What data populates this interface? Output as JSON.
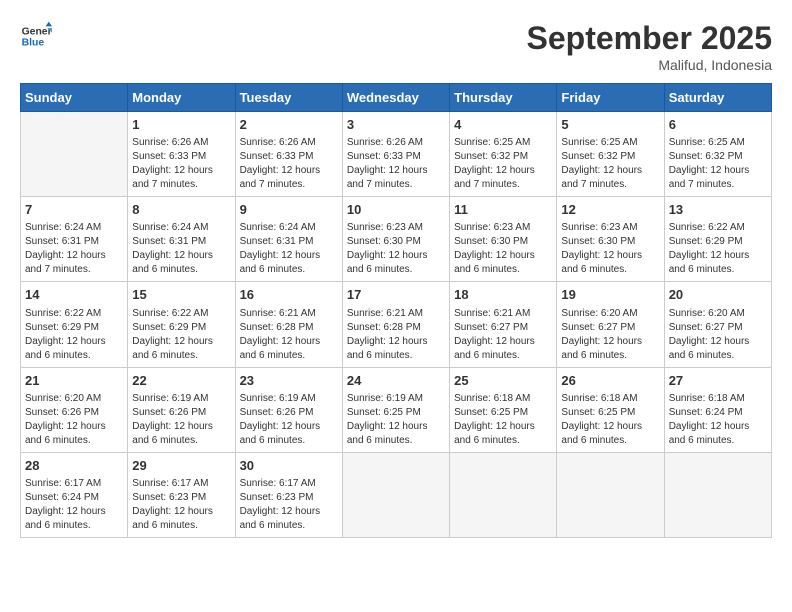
{
  "header": {
    "logo_general": "General",
    "logo_blue": "Blue",
    "month": "September 2025",
    "location": "Malifud, Indonesia"
  },
  "days_of_week": [
    "Sunday",
    "Monday",
    "Tuesday",
    "Wednesday",
    "Thursday",
    "Friday",
    "Saturday"
  ],
  "weeks": [
    [
      {
        "day": "",
        "empty": true
      },
      {
        "day": "1",
        "sunrise": "6:26 AM",
        "sunset": "6:33 PM",
        "daylight": "12 hours and 7 minutes."
      },
      {
        "day": "2",
        "sunrise": "6:26 AM",
        "sunset": "6:33 PM",
        "daylight": "12 hours and 7 minutes."
      },
      {
        "day": "3",
        "sunrise": "6:26 AM",
        "sunset": "6:33 PM",
        "daylight": "12 hours and 7 minutes."
      },
      {
        "day": "4",
        "sunrise": "6:25 AM",
        "sunset": "6:32 PM",
        "daylight": "12 hours and 7 minutes."
      },
      {
        "day": "5",
        "sunrise": "6:25 AM",
        "sunset": "6:32 PM",
        "daylight": "12 hours and 7 minutes."
      },
      {
        "day": "6",
        "sunrise": "6:25 AM",
        "sunset": "6:32 PM",
        "daylight": "12 hours and 7 minutes."
      }
    ],
    [
      {
        "day": "7",
        "sunrise": "6:24 AM",
        "sunset": "6:31 PM",
        "daylight": "12 hours and 7 minutes."
      },
      {
        "day": "8",
        "sunrise": "6:24 AM",
        "sunset": "6:31 PM",
        "daylight": "12 hours and 6 minutes."
      },
      {
        "day": "9",
        "sunrise": "6:24 AM",
        "sunset": "6:31 PM",
        "daylight": "12 hours and 6 minutes."
      },
      {
        "day": "10",
        "sunrise": "6:23 AM",
        "sunset": "6:30 PM",
        "daylight": "12 hours and 6 minutes."
      },
      {
        "day": "11",
        "sunrise": "6:23 AM",
        "sunset": "6:30 PM",
        "daylight": "12 hours and 6 minutes."
      },
      {
        "day": "12",
        "sunrise": "6:23 AM",
        "sunset": "6:30 PM",
        "daylight": "12 hours and 6 minutes."
      },
      {
        "day": "13",
        "sunrise": "6:22 AM",
        "sunset": "6:29 PM",
        "daylight": "12 hours and 6 minutes."
      }
    ],
    [
      {
        "day": "14",
        "sunrise": "6:22 AM",
        "sunset": "6:29 PM",
        "daylight": "12 hours and 6 minutes."
      },
      {
        "day": "15",
        "sunrise": "6:22 AM",
        "sunset": "6:29 PM",
        "daylight": "12 hours and 6 minutes."
      },
      {
        "day": "16",
        "sunrise": "6:21 AM",
        "sunset": "6:28 PM",
        "daylight": "12 hours and 6 minutes."
      },
      {
        "day": "17",
        "sunrise": "6:21 AM",
        "sunset": "6:28 PM",
        "daylight": "12 hours and 6 minutes."
      },
      {
        "day": "18",
        "sunrise": "6:21 AM",
        "sunset": "6:27 PM",
        "daylight": "12 hours and 6 minutes."
      },
      {
        "day": "19",
        "sunrise": "6:20 AM",
        "sunset": "6:27 PM",
        "daylight": "12 hours and 6 minutes."
      },
      {
        "day": "20",
        "sunrise": "6:20 AM",
        "sunset": "6:27 PM",
        "daylight": "12 hours and 6 minutes."
      }
    ],
    [
      {
        "day": "21",
        "sunrise": "6:20 AM",
        "sunset": "6:26 PM",
        "daylight": "12 hours and 6 minutes."
      },
      {
        "day": "22",
        "sunrise": "6:19 AM",
        "sunset": "6:26 PM",
        "daylight": "12 hours and 6 minutes."
      },
      {
        "day": "23",
        "sunrise": "6:19 AM",
        "sunset": "6:26 PM",
        "daylight": "12 hours and 6 minutes."
      },
      {
        "day": "24",
        "sunrise": "6:19 AM",
        "sunset": "6:25 PM",
        "daylight": "12 hours and 6 minutes."
      },
      {
        "day": "25",
        "sunrise": "6:18 AM",
        "sunset": "6:25 PM",
        "daylight": "12 hours and 6 minutes."
      },
      {
        "day": "26",
        "sunrise": "6:18 AM",
        "sunset": "6:25 PM",
        "daylight": "12 hours and 6 minutes."
      },
      {
        "day": "27",
        "sunrise": "6:18 AM",
        "sunset": "6:24 PM",
        "daylight": "12 hours and 6 minutes."
      }
    ],
    [
      {
        "day": "28",
        "sunrise": "6:17 AM",
        "sunset": "6:24 PM",
        "daylight": "12 hours and 6 minutes."
      },
      {
        "day": "29",
        "sunrise": "6:17 AM",
        "sunset": "6:23 PM",
        "daylight": "12 hours and 6 minutes."
      },
      {
        "day": "30",
        "sunrise": "6:17 AM",
        "sunset": "6:23 PM",
        "daylight": "12 hours and 6 minutes."
      },
      {
        "day": "",
        "empty": true
      },
      {
        "day": "",
        "empty": true
      },
      {
        "day": "",
        "empty": true
      },
      {
        "day": "",
        "empty": true
      }
    ]
  ]
}
